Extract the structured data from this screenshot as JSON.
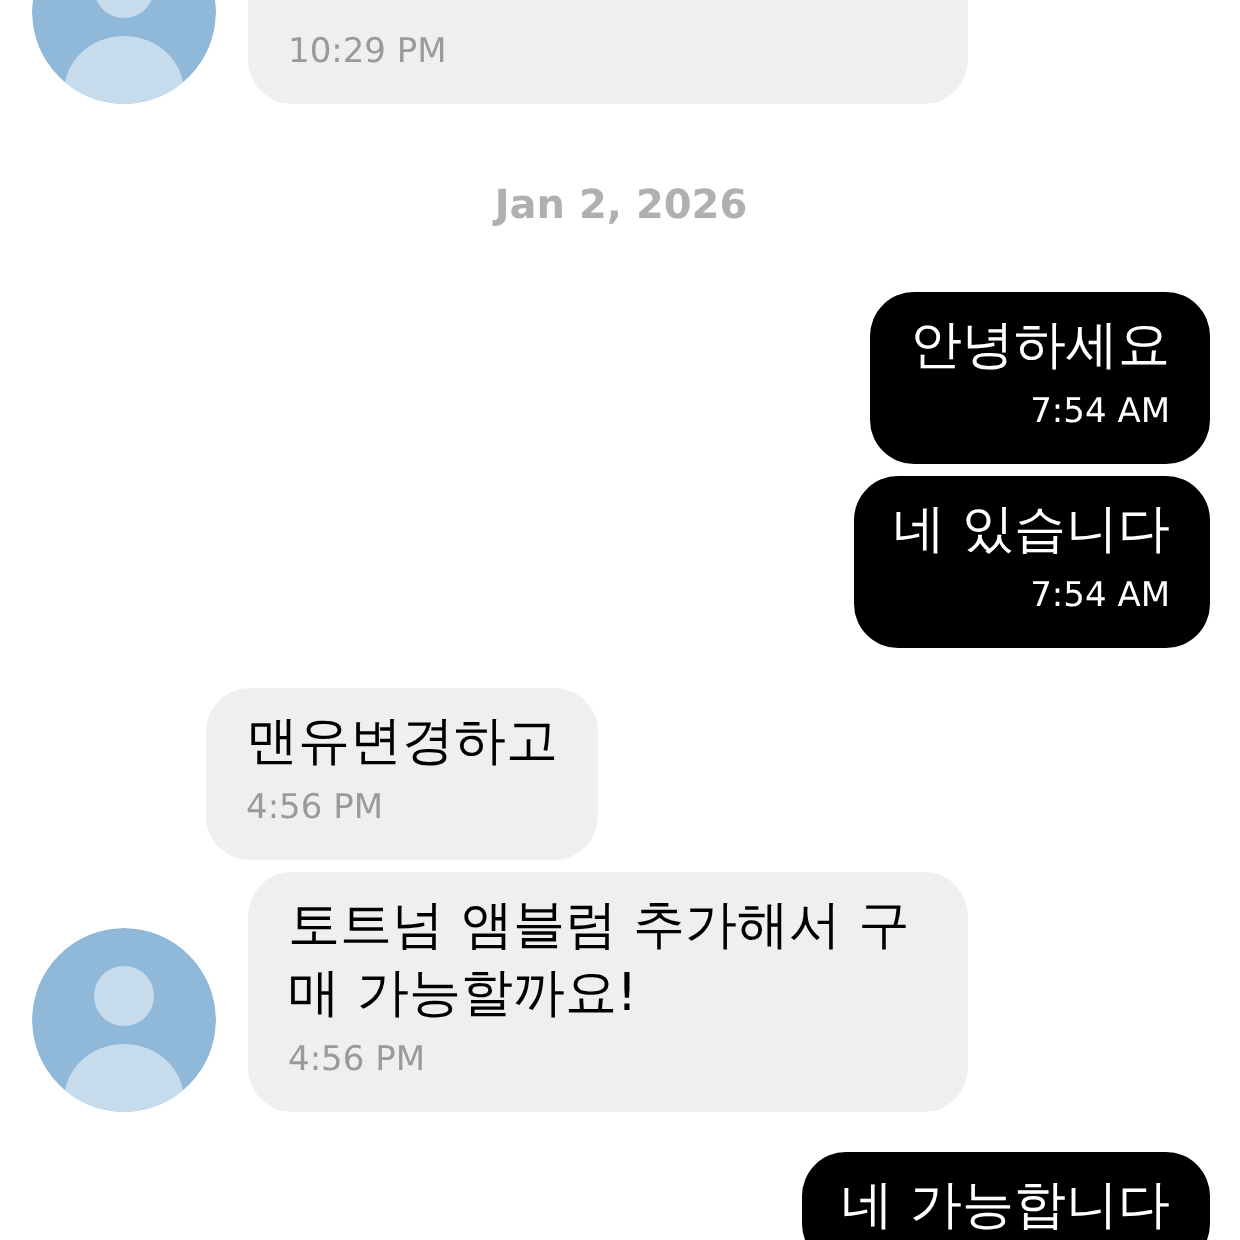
{
  "messages": [
    {
      "kind": "incoming",
      "avatar": true,
      "time": "10:29 PM"
    },
    {
      "kind": "date",
      "text": "Jan 2, 2026"
    },
    {
      "kind": "outgoing",
      "text": "안녕하세요",
      "time": "7:54 AM"
    },
    {
      "kind": "outgoing",
      "text": "네 있습니다",
      "time": "7:54 AM"
    },
    {
      "kind": "incoming",
      "avatar": false,
      "text": "맨유변경하고",
      "time": "4:56 PM"
    },
    {
      "kind": "incoming",
      "avatar": true,
      "text": "토트넘 앰블럼 추가해서 구매 가능할까요!",
      "time": "4:56 PM"
    },
    {
      "kind": "outgoing",
      "text": "네 가능합니다"
    }
  ]
}
